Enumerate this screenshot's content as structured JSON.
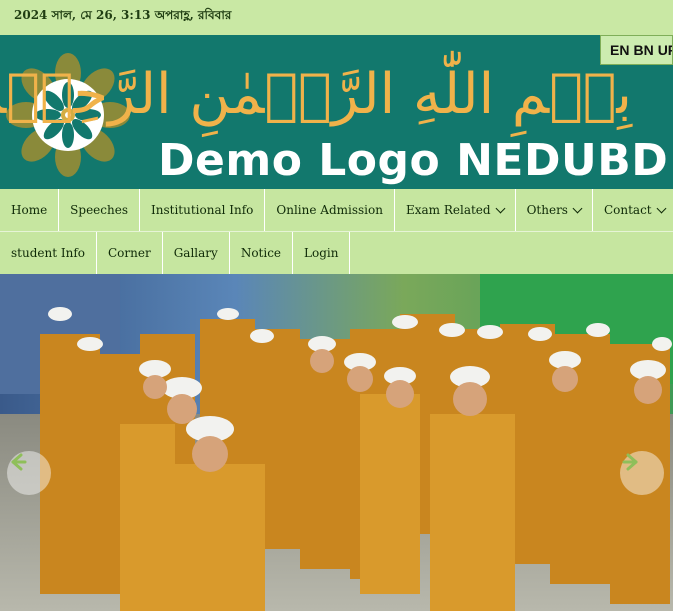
{
  "topbar": {
    "date_text": "2024 সাল, মে 26, 3:13 অপরাহ্ণ, রবিবার"
  },
  "banner": {
    "bismillah": "بِسۡمِ اللّٰهِ الرَّحۡمٰنِ الرَّحِیۡمِ",
    "logo_text": "Demo Logo NEDUBD"
  },
  "language": {
    "options": [
      "EN",
      "BN",
      "UR"
    ]
  },
  "nav": {
    "row1": [
      {
        "label": "Home",
        "dropdown": false
      },
      {
        "label": "Speeches",
        "dropdown": false
      },
      {
        "label": "Institutional Info",
        "dropdown": false
      },
      {
        "label": "Online Admission",
        "dropdown": false
      },
      {
        "label": "Exam Related",
        "dropdown": true
      },
      {
        "label": "Others",
        "dropdown": true
      },
      {
        "label": "Contact",
        "dropdown": true
      }
    ],
    "row2": [
      {
        "label": "student Info",
        "dropdown": false
      },
      {
        "label": "Corner",
        "dropdown": false
      },
      {
        "label": "Gallary",
        "dropdown": false
      },
      {
        "label": "Notice",
        "dropdown": false
      },
      {
        "label": "Login",
        "dropdown": false
      }
    ]
  },
  "slider": {
    "left_arrow_icon": "arrow-left-icon",
    "right_arrow_icon": "arrow-right-icon",
    "arrow_color": "#8fbf5a"
  },
  "colors": {
    "banner_bg": "#12786d",
    "bismillah": "#f0b24a",
    "nav_bg": "#c6e6a0"
  }
}
